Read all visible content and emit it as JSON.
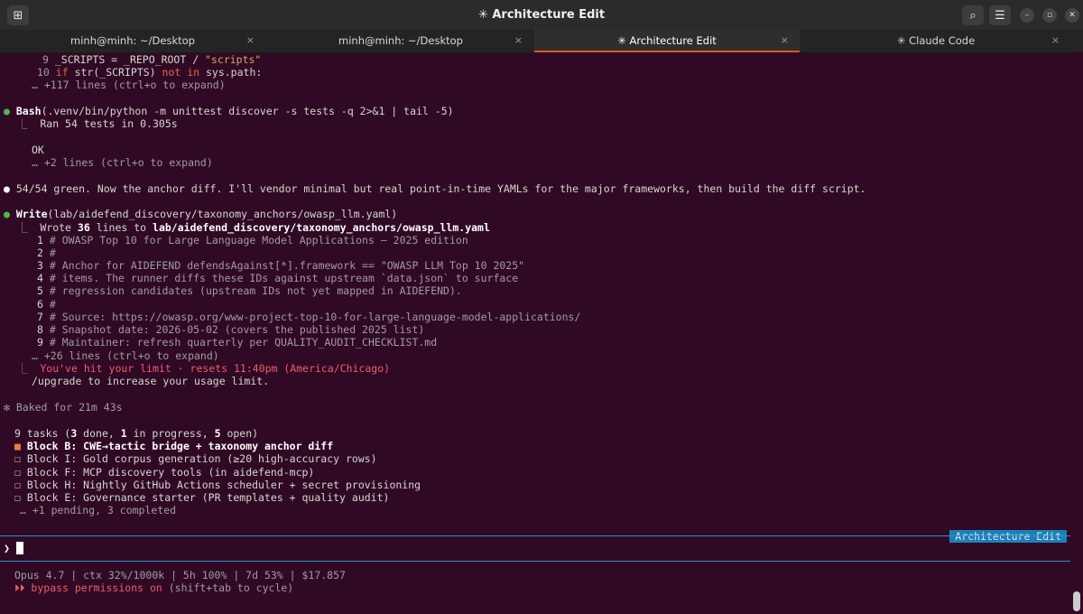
{
  "window": {
    "title": "✳ Architecture Edit",
    "new_tab_icon": "terminal-plus-icon",
    "search_icon": "search-icon",
    "menu_icon": "hamburger-menu-icon"
  },
  "tabs": [
    {
      "label": "minh@minh: ~/Desktop",
      "close": "×",
      "active": false
    },
    {
      "label": "minh@minh: ~/Desktop",
      "close": "×",
      "active": false
    },
    {
      "label": "✳ Architecture Edit",
      "close": "×",
      "active": true
    },
    {
      "label": "✳ Claude Code",
      "close": "×",
      "active": false
    }
  ],
  "term": {
    "code_top": [
      {
        "n": "9",
        "text": "_SCRIPTS = _REPO_ROOT / ",
        "str": "\"scripts\""
      },
      {
        "n": "10",
        "kw": "if",
        "mid": " str(_SCRIPTS) ",
        "kw2": "not in",
        "tail": " sys.path:"
      }
    ],
    "expand1": "… +117 lines (ctrl+o to expand)",
    "bash_tool": "Bash",
    "bash_cmd": "(.venv/bin/python -m unittest discover -s tests -q 2>&1 | tail -5)",
    "bash_out1": "Ran 54 tests in 0.305s",
    "bash_out2": "OK",
    "expand2": "… +2 lines (ctrl+o to expand)",
    "message": "54/54 green. Now the anchor diff. I'll vendor minimal but real point-in-time YAMLs for the major frameworks, then build the diff script.",
    "write_tool": "Write",
    "write_arg": "(lab/aidefend_discovery/taxonomy_anchors/owasp_llm.yaml)",
    "wrote_prefix": "Wrote ",
    "wrote_count": "36",
    "wrote_mid": " lines to ",
    "wrote_path": "lab/aidefend_discovery/taxonomy_anchors/owasp_llm.yaml",
    "yaml_lines": [
      {
        "n": "1",
        "text": "# OWASP Top 10 for Large Language Model Applications — 2025 edition"
      },
      {
        "n": "2",
        "text": "#"
      },
      {
        "n": "3",
        "text": "# Anchor for AIDEFEND defendsAgainst[*].framework == \"OWASP LLM Top 10 2025\""
      },
      {
        "n": "4",
        "text": "# items. The runner diffs these IDs against upstream `data.json` to surface"
      },
      {
        "n": "5",
        "text": "# regression candidates (upstream IDs not yet mapped in AIDEFEND)."
      },
      {
        "n": "6",
        "text": "#"
      },
      {
        "n": "7",
        "text": "# Source: https://owasp.org/www-project-top-10-for-large-language-model-applications/"
      },
      {
        "n": "8",
        "text": "# Snapshot date: 2026-05-02 (covers the published 2025 list)"
      },
      {
        "n": "9",
        "text": "# Maintainer: refresh quarterly per QUALITY_AUDIT_CHECKLIST.md"
      }
    ],
    "expand3": "… +26 lines (ctrl+o to expand)",
    "limit": "You've hit your limit · resets 11:40pm (America/Chicago)",
    "upgrade": "/upgrade to increase your usage limit.",
    "baked": "✻ Baked for 21m 43s",
    "tasks_header": {
      "a": "9 tasks (",
      "done": "3",
      "b": " done, ",
      "prog": "1",
      "c": " in progress, ",
      "open": "5",
      "d": " open)"
    },
    "tasks": [
      {
        "box": "■",
        "label": "Block B: CWE→tactic bridge + taxonomy anchor diff",
        "state": "in-progress"
      },
      {
        "box": "☐",
        "label": "Block I: Gold corpus generation (≥20 high-accuracy rows)",
        "state": "open"
      },
      {
        "box": "☐",
        "label": "Block F: MCP discovery tools (in aidefend-mcp)",
        "state": "open"
      },
      {
        "box": "☐",
        "label": "Block H: Nightly GitHub Actions scheduler + secret provisioning",
        "state": "open"
      },
      {
        "box": "☐",
        "label": "Block E: Governance starter (PR templates + quality audit)",
        "state": "open"
      }
    ],
    "tasks_more": "… +1 pending, 3 completed",
    "badge": "Architecture Edit",
    "prompt": "❯",
    "status": "Opus 4.7 | ctx 32%/1000k | 5h 100% | 7d 53% | $17.857",
    "bypass_arrows": "⏵⏵",
    "bypass": " bypass permissions on",
    "bypass_hint": " (shift+tab to cycle)"
  },
  "colors": {
    "bg": "#300a24",
    "accent": "#e95420",
    "divider": "#2d8fd0",
    "green": "#4fb84f",
    "error": "#ef5b6a"
  }
}
